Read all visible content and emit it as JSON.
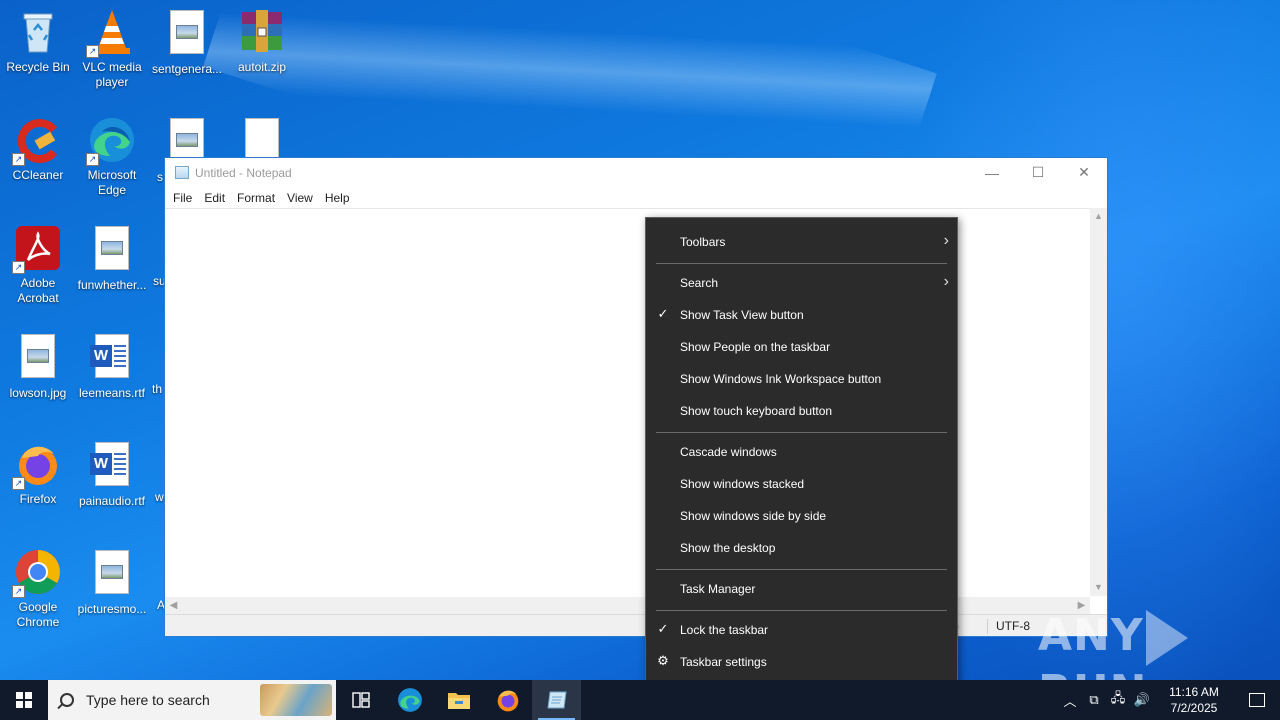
{
  "desktop": {
    "icons": [
      {
        "label": "Recycle Bin"
      },
      {
        "label": "VLC media player"
      },
      {
        "label": "sentgenera..."
      },
      {
        "label": "autoit.zip"
      },
      {
        "label": "CCleaner"
      },
      {
        "label": "Microsoft Edge"
      },
      {
        "label": "s"
      },
      {
        "label": "Adobe Acrobat"
      },
      {
        "label": "funwhether..."
      },
      {
        "label": "su"
      },
      {
        "label": "lowson.jpg"
      },
      {
        "label": "leemeans.rtf"
      },
      {
        "label": "th"
      },
      {
        "label": "Firefox"
      },
      {
        "label": "painaudio.rtf"
      },
      {
        "label": "w"
      },
      {
        "label": "Google Chrome"
      },
      {
        "label": "picturesmo..."
      },
      {
        "label": "A"
      }
    ]
  },
  "notepad": {
    "title": "Untitled - Notepad",
    "menu": [
      "File",
      "Edit",
      "Format",
      "View",
      "Help"
    ],
    "status_paren": ")",
    "encoding": "UTF-8"
  },
  "context_menu": {
    "items": [
      {
        "label": "Toolbars",
        "submenu": true
      },
      {
        "label": "Search",
        "submenu": true
      },
      {
        "label": "Show Task View button",
        "checked": true
      },
      {
        "label": "Show People on the taskbar"
      },
      {
        "label": "Show Windows Ink Workspace button"
      },
      {
        "label": "Show touch keyboard button"
      },
      {
        "label": "Cascade windows"
      },
      {
        "label": "Show windows stacked"
      },
      {
        "label": "Show windows side by side"
      },
      {
        "label": "Show the desktop"
      },
      {
        "label": "Task Manager"
      },
      {
        "label": "Lock the taskbar",
        "checked": true
      },
      {
        "label": "Taskbar settings",
        "icon": "gear-icon"
      }
    ]
  },
  "taskbar": {
    "search_placeholder": "Type here to search",
    "time": "11:16 AM",
    "date": "7/2/2025"
  },
  "watermark": {
    "left": "ANY",
    "right": "RUN"
  }
}
